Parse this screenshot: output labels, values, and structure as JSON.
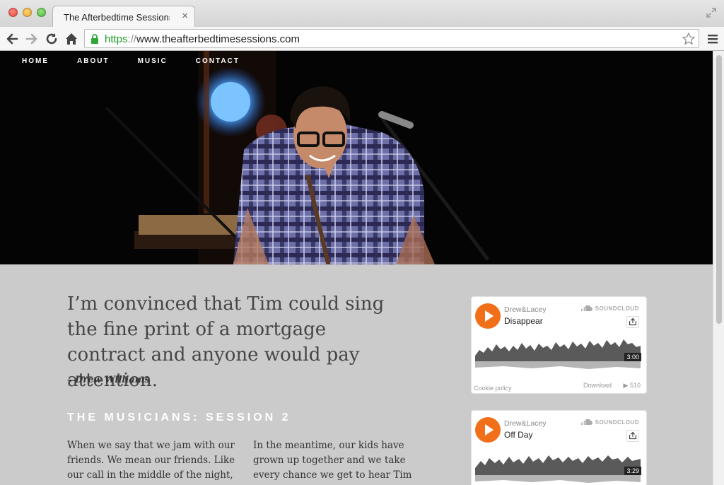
{
  "browser": {
    "tab_title": "The Afterbedtime Sessions",
    "url_scheme": "https",
    "url_sep": "://",
    "url_rest": "www.theafterbedtimesessions.com"
  },
  "nav": {
    "items": [
      "HOME",
      "ABOUT",
      "MUSIC",
      "CONTACT"
    ]
  },
  "quote": {
    "text": "I’m convinced that Tim could sing the fine print of a mortgage contract and anyone would pay attention.",
    "author": "– Drew Williams"
  },
  "section": {
    "heading": "THE MUSICIANS: SESSION 2"
  },
  "body": {
    "left": "When we say that we jam with our friends. We mean our friends. Like our call in the middle of the night, know",
    "right": "In the meantime, our kids have grown up together and we take every chance we get to hear Tim sing. I’m convinced"
  },
  "players": [
    {
      "user": "Drew&Lacey",
      "track": "Disappear",
      "brand": "SOUNDCLOUD",
      "duration": "3:00",
      "cookie": "Cookie policy",
      "download": "Download",
      "plays": "▶ 510"
    },
    {
      "user": "Drew&Lacey",
      "track": "Off Day",
      "brand": "SOUNDCLOUD",
      "duration": "3:29"
    }
  ],
  "colors": {
    "soundcloud_orange": "#f26f1a",
    "page_bg": "#cbcbcb",
    "secure_green": "#1e9b2a"
  }
}
